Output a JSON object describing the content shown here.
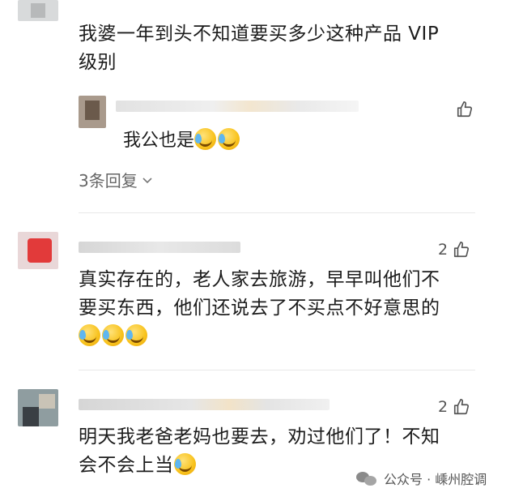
{
  "comments": [
    {
      "text_line1": "我婆一年到头不知道要买多少这种产品  VIP",
      "text_line2": "级别"
    },
    {
      "likes": "2",
      "text_line1": "真实存在的，老人家去旅游，早早叫他们不",
      "text_line2": "要买东西，他们还说去了不买点不好意思的"
    },
    {
      "likes": "2",
      "text_line1": "明天我老爸老妈也要去，劝过他们了！不知",
      "text_line2": "会不会上当"
    }
  ],
  "reply": {
    "text": "我公也是"
  },
  "more_replies": {
    "label": "3条回复"
  },
  "watermark": {
    "text": "公众号 · 嵊州腔调"
  },
  "colors": {
    "divider": "#e8e8e8",
    "meta": "#666666",
    "text": "#1c1c1c"
  }
}
